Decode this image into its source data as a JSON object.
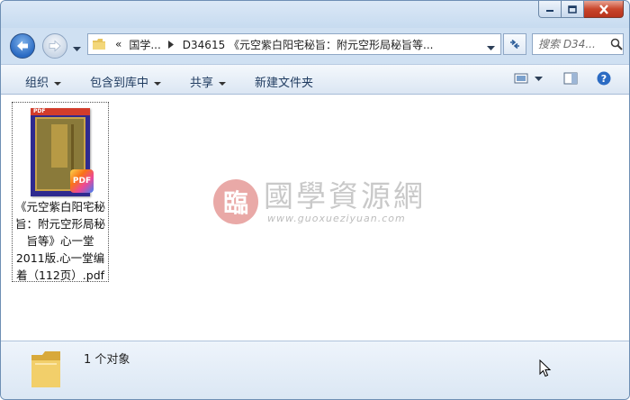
{
  "address_bar": {
    "overflow": "«",
    "crumbs": [
      "国学...",
      "D34615 《元空紫白阳宅秘旨：附元空形局秘旨等..."
    ]
  },
  "search": {
    "placeholder": "搜索 D34..."
  },
  "toolbar": {
    "organize": "组织",
    "include_in_library": "包含到库中",
    "share": "共享",
    "new_folder": "新建文件夹"
  },
  "file": {
    "name_lines": [
      "《元空紫白阳宅秘",
      "旨：附元空形局秘",
      "旨等》心一堂",
      "2011版.心一堂编",
      "着（112页）.pdf"
    ],
    "badge": "PDF",
    "thumb_strip": "PDF"
  },
  "watermark": {
    "seal": "臨",
    "chinese": "國學資源網",
    "url": "www.guoxueziyuan.com"
  },
  "status": {
    "item_count": "1 个对象"
  },
  "colors": {
    "window_frame": "#cfe0f2",
    "close_button": "#c9462c",
    "back_button": "#2b6bc3",
    "content_bg": "#ffffff",
    "watermark_seal": "#e9a9a7"
  }
}
